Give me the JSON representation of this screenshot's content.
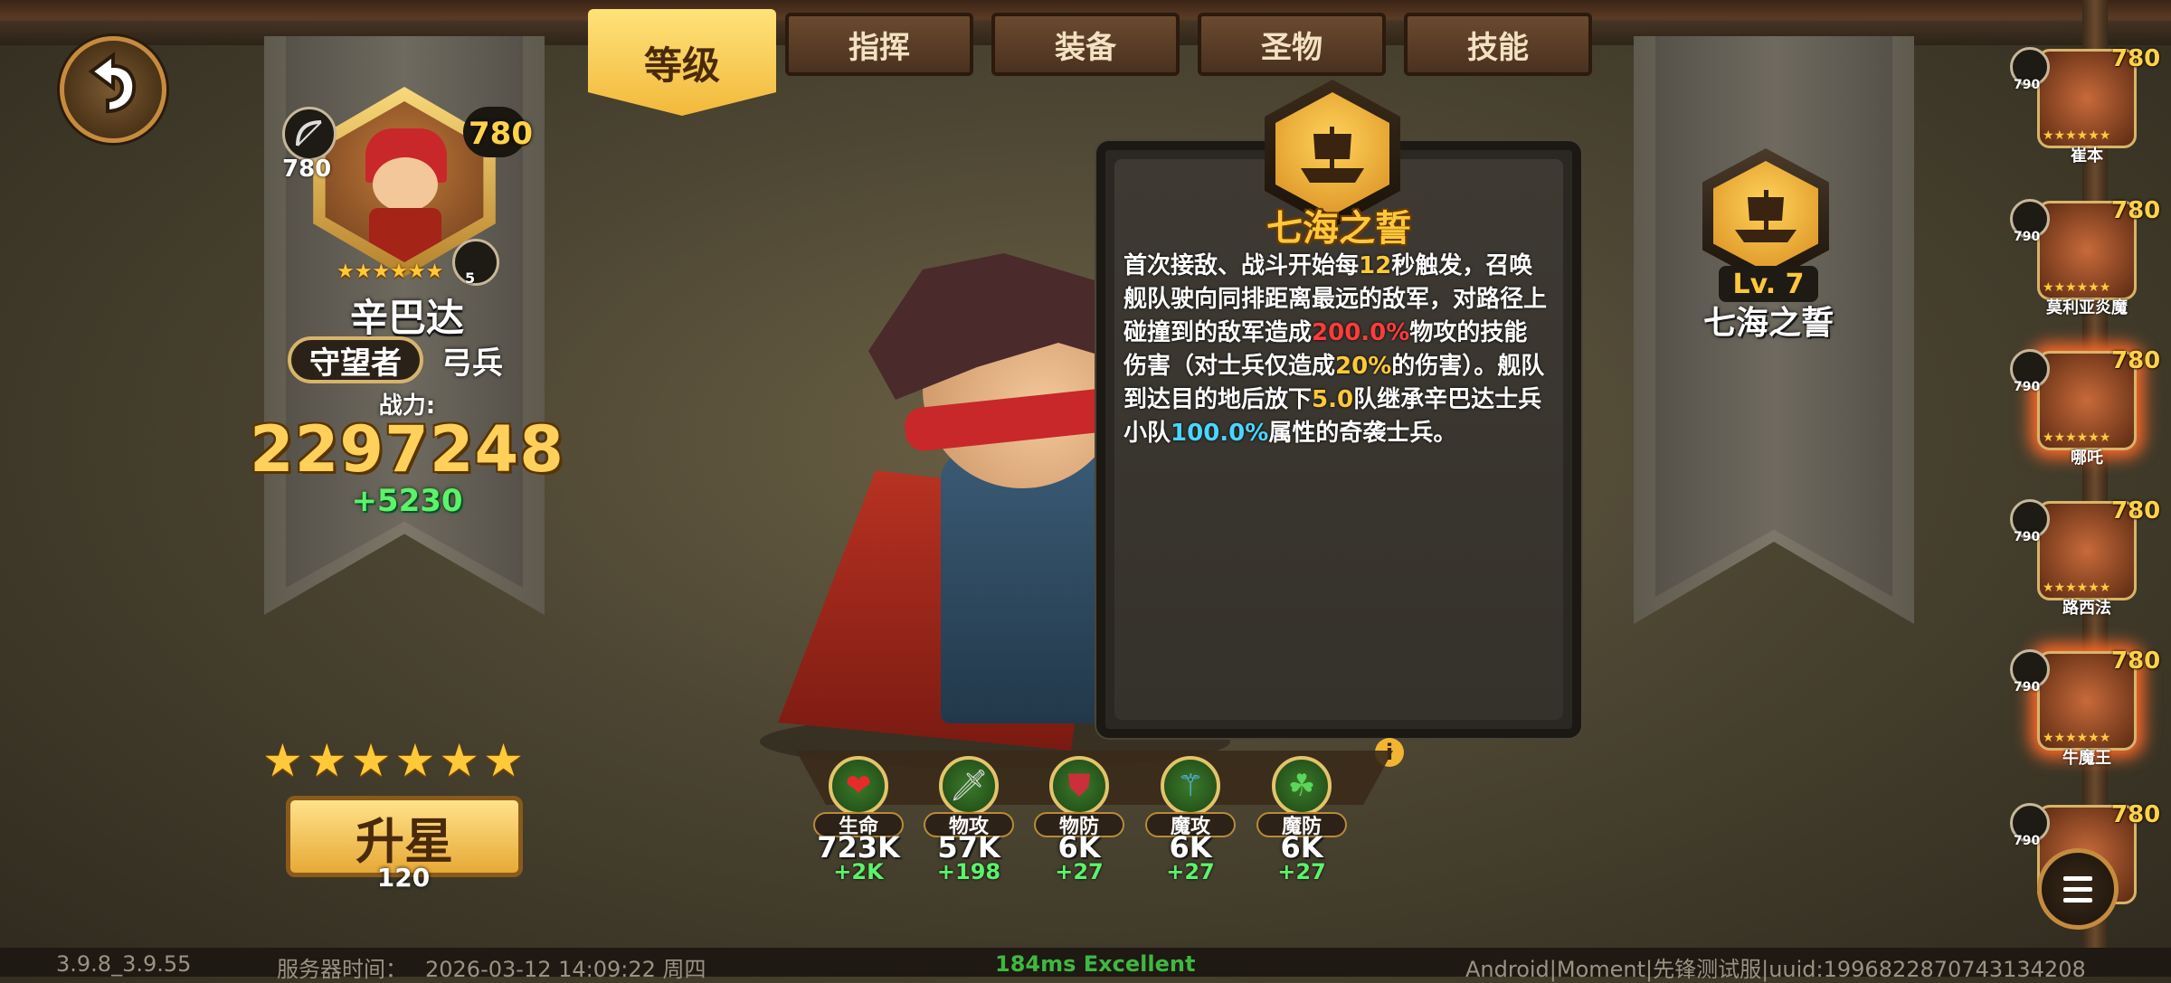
{
  "tabs": [
    {
      "label": "等级",
      "active": true
    },
    {
      "label": "指挥",
      "active": false
    },
    {
      "label": "装备",
      "active": false
    },
    {
      "label": "圣物",
      "active": false
    },
    {
      "label": "技能",
      "active": false
    }
  ],
  "hero": {
    "name": "辛巴达",
    "class_label": "守望者",
    "type_label": "弓兵",
    "level": "780",
    "sub_level": "780",
    "gear_count": "5",
    "power_label": "战力:",
    "power_value": "2297248",
    "power_delta": "+5230"
  },
  "upgrade": {
    "stars": "★★★★★★",
    "label": "升星",
    "cost": "120"
  },
  "skill": {
    "title": "七海之誓",
    "desc_parts": {
      "p1": "首次接敌、战斗开始每",
      "n1": "12",
      "p2": "秒触发，召唤舰队驶向同排距离最远的敌军，对路径上碰撞到的敌军造成",
      "n2": "200.0%",
      "p3": "物攻的技能伤害（对士兵仅造成",
      "n3": "20%",
      "p4": "的伤害）。舰队到达目的地后放下",
      "n4": "5.0",
      "p5": "队继承辛巴达士兵小队",
      "n5": "100.0%",
      "p6": "属性的奇袭士兵。"
    },
    "level_label": "Lv. 7",
    "name_below": "七海之誓",
    "info_icon": "i"
  },
  "stats": [
    {
      "label": "生命",
      "value": "723K",
      "delta": "+2K",
      "icon": "heart-icon",
      "glyph": "❤",
      "color": "#e82a2a"
    },
    {
      "label": "物攻",
      "value": "57K",
      "delta": "+198",
      "icon": "sword-icon",
      "glyph": "🗡",
      "color": "#dddddd"
    },
    {
      "label": "物防",
      "value": "6K",
      "delta": "+27",
      "icon": "shield-icon",
      "glyph": "⛊",
      "color": "#c9303a"
    },
    {
      "label": "魔攻",
      "value": "6K",
      "delta": "+27",
      "icon": "magic-staff-icon",
      "glyph": "⚚",
      "color": "#5ab8ff"
    },
    {
      "label": "魔防",
      "value": "6K",
      "delta": "+27",
      "icon": "clover-icon",
      "glyph": "☘",
      "color": "#5cd65c"
    }
  ],
  "roster": [
    {
      "name": "崔本",
      "level": "780",
      "sub_level": "790",
      "stars": "★★★★★★",
      "glow": false,
      "class_icon": "shield-class-icon"
    },
    {
      "name": "莫利亚炎魔",
      "level": "780",
      "sub_level": "790",
      "stars": "★★★★★★",
      "glow": false,
      "class_icon": "spear-class-icon"
    },
    {
      "name": "哪吒",
      "level": "780",
      "sub_level": "790",
      "stars": "★★★★★★",
      "glow": true,
      "class_icon": "magic-class-icon"
    },
    {
      "name": "路西法",
      "level": "780",
      "sub_level": "790",
      "stars": "★★★★★★",
      "glow": false,
      "class_icon": "magic-class-icon"
    },
    {
      "name": "牛魔王",
      "level": "780",
      "sub_level": "790",
      "stars": "★★★★★★",
      "glow": true,
      "class_icon": "magic-class-icon"
    },
    {
      "name": "",
      "level": "780",
      "sub_level": "790",
      "stars": "",
      "glow": false,
      "class_icon": "shield-class-icon"
    }
  ],
  "footer": {
    "version": "3.9.8_3.9.55",
    "server_time_label": "服务器时间：",
    "server_time": "2026-03-12  14:09:22  周四",
    "ping": "184ms Excellent",
    "device_info": "Android|Moment|先锋测试服|uuid:1996822870743134208"
  },
  "colors": {
    "accent_gold": "#ffc93a",
    "positive_green": "#5cf26b",
    "damage_red": "#ff3b3b",
    "ping_green": "#3fb83f"
  }
}
